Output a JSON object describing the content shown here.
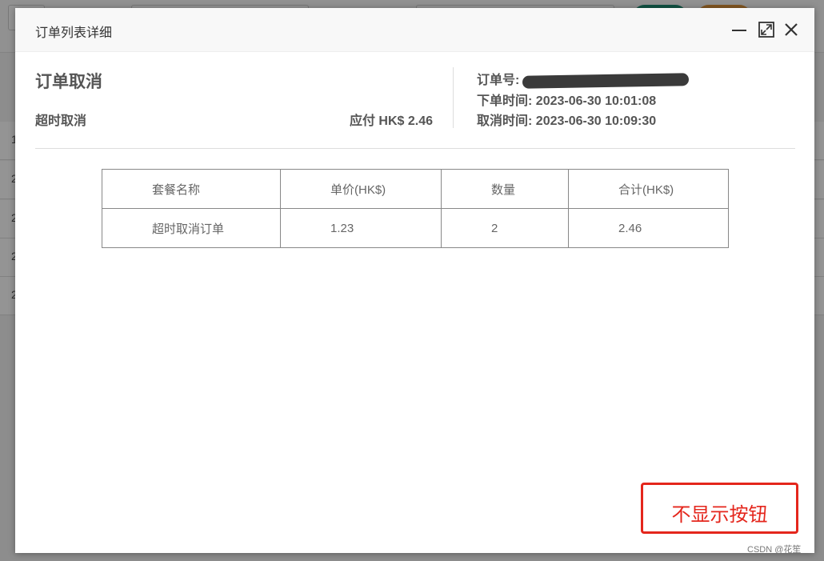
{
  "modal": {
    "title": "订单列表详细",
    "icons": [
      "minimize-icon",
      "maximize-icon",
      "close-icon"
    ]
  },
  "order": {
    "status": "订单取消",
    "sub_status": "超时取消",
    "amount": "应付 HK$ 2.46",
    "order_no_label": "订单号:",
    "order_time_label": "下单时间:",
    "order_time": "2023-06-30 10:01:08",
    "cancel_time_label": "取消时间:",
    "cancel_time": "2023-06-30 10:09:30"
  },
  "table": {
    "headers": [
      "套餐名称",
      "单价(HK$)",
      "数量",
      "合计(HK$)"
    ],
    "rows": [
      [
        "超时取消订单",
        "1.23",
        "2",
        "2.46"
      ]
    ]
  },
  "annotation": {
    "text": "不显示按钮"
  },
  "watermark": "CSDN @花笙",
  "background": {
    "row_numbers": [
      "1",
      "2",
      "2",
      "2",
      "2"
    ],
    "button_colors": [
      "#1e8e74",
      "#e0953a"
    ]
  }
}
